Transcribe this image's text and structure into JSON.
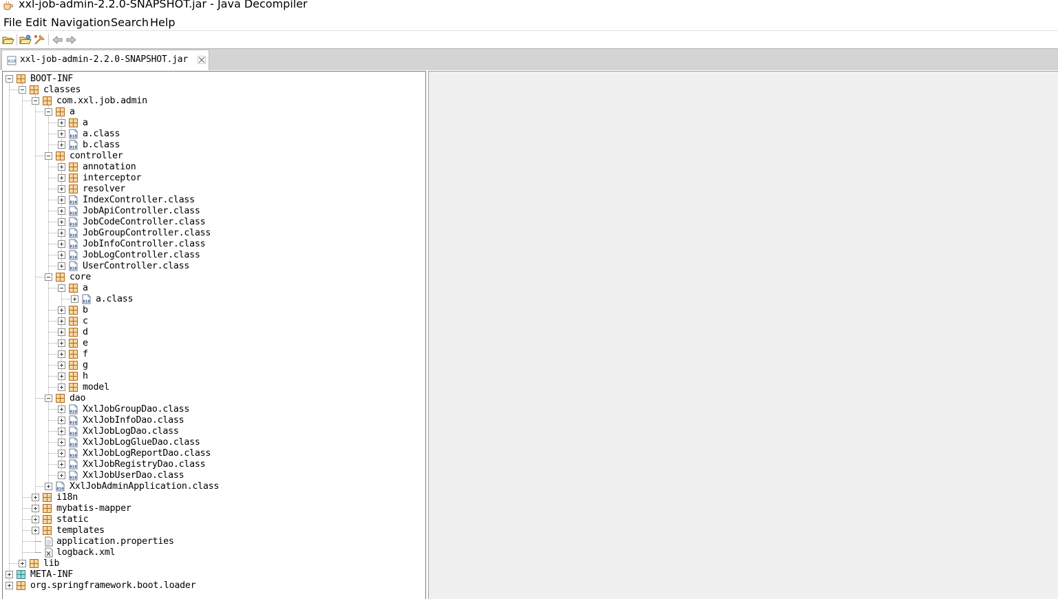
{
  "window": {
    "title": "xxl-job-admin-2.2.0-SNAPSHOT.jar - Java Decompiler"
  },
  "menu": [
    "File",
    "Edit",
    "Navigation",
    "Search",
    "Help"
  ],
  "toolbar": {
    "buttons": [
      "open-file-icon",
      "open-type-icon",
      "reference-icon",
      "back-icon",
      "forward-icon"
    ]
  },
  "tab": {
    "label": "xxl-job-admin-2.2.0-SNAPSHOT.jar"
  },
  "tree": [
    {
      "label": "BOOT-INF",
      "depth": 0,
      "type": "package",
      "state": "expanded"
    },
    {
      "label": "classes",
      "depth": 1,
      "type": "package",
      "state": "expanded"
    },
    {
      "label": "com.xxl.job.admin",
      "depth": 2,
      "type": "package",
      "state": "expanded"
    },
    {
      "label": "a",
      "depth": 3,
      "type": "package",
      "state": "expanded"
    },
    {
      "label": "a",
      "depth": 4,
      "type": "package",
      "state": "collapsed"
    },
    {
      "label": "a.class",
      "depth": 4,
      "type": "class",
      "state": "collapsed"
    },
    {
      "label": "b.class",
      "depth": 4,
      "type": "class",
      "state": "collapsed"
    },
    {
      "label": "controller",
      "depth": 3,
      "type": "package",
      "state": "expanded"
    },
    {
      "label": "annotation",
      "depth": 4,
      "type": "package",
      "state": "collapsed"
    },
    {
      "label": "interceptor",
      "depth": 4,
      "type": "package",
      "state": "collapsed"
    },
    {
      "label": "resolver",
      "depth": 4,
      "type": "package",
      "state": "collapsed"
    },
    {
      "label": "IndexController.class",
      "depth": 4,
      "type": "class",
      "state": "collapsed"
    },
    {
      "label": "JobApiController.class",
      "depth": 4,
      "type": "class",
      "state": "collapsed"
    },
    {
      "label": "JobCodeController.class",
      "depth": 4,
      "type": "class",
      "state": "collapsed"
    },
    {
      "label": "JobGroupController.class",
      "depth": 4,
      "type": "class",
      "state": "collapsed"
    },
    {
      "label": "JobInfoController.class",
      "depth": 4,
      "type": "class",
      "state": "collapsed"
    },
    {
      "label": "JobLogController.class",
      "depth": 4,
      "type": "class",
      "state": "collapsed"
    },
    {
      "label": "UserController.class",
      "depth": 4,
      "type": "class",
      "state": "collapsed"
    },
    {
      "label": "core",
      "depth": 3,
      "type": "package",
      "state": "expanded"
    },
    {
      "label": "a",
      "depth": 4,
      "type": "package",
      "state": "expanded"
    },
    {
      "label": "a.class",
      "depth": 5,
      "type": "class",
      "state": "collapsed"
    },
    {
      "label": "b",
      "depth": 4,
      "type": "package",
      "state": "collapsed"
    },
    {
      "label": "c",
      "depth": 4,
      "type": "package",
      "state": "collapsed"
    },
    {
      "label": "d",
      "depth": 4,
      "type": "package",
      "state": "collapsed"
    },
    {
      "label": "e",
      "depth": 4,
      "type": "package",
      "state": "collapsed"
    },
    {
      "label": "f",
      "depth": 4,
      "type": "package",
      "state": "collapsed"
    },
    {
      "label": "g",
      "depth": 4,
      "type": "package",
      "state": "collapsed"
    },
    {
      "label": "h",
      "depth": 4,
      "type": "package",
      "state": "collapsed"
    },
    {
      "label": "model",
      "depth": 4,
      "type": "package",
      "state": "collapsed"
    },
    {
      "label": "dao",
      "depth": 3,
      "type": "package",
      "state": "expanded"
    },
    {
      "label": "XxlJobGroupDao.class",
      "depth": 4,
      "type": "class",
      "state": "collapsed"
    },
    {
      "label": "XxlJobInfoDao.class",
      "depth": 4,
      "type": "class",
      "state": "collapsed"
    },
    {
      "label": "XxlJobLogDao.class",
      "depth": 4,
      "type": "class",
      "state": "collapsed"
    },
    {
      "label": "XxlJobLogGlueDao.class",
      "depth": 4,
      "type": "class",
      "state": "collapsed"
    },
    {
      "label": "XxlJobLogReportDao.class",
      "depth": 4,
      "type": "class",
      "state": "collapsed"
    },
    {
      "label": "XxlJobRegistryDao.class",
      "depth": 4,
      "type": "class",
      "state": "collapsed"
    },
    {
      "label": "XxlJobUserDao.class",
      "depth": 4,
      "type": "class",
      "state": "collapsed"
    },
    {
      "label": "XxlJobAdminApplication.class",
      "depth": 3,
      "type": "class",
      "state": "collapsed"
    },
    {
      "label": "i18n",
      "depth": 2,
      "type": "package",
      "state": "collapsed"
    },
    {
      "label": "mybatis-mapper",
      "depth": 2,
      "type": "package",
      "state": "collapsed"
    },
    {
      "label": "static",
      "depth": 2,
      "type": "package",
      "state": "collapsed"
    },
    {
      "label": "templates",
      "depth": 2,
      "type": "package",
      "state": "collapsed"
    },
    {
      "label": "application.properties",
      "depth": 2,
      "type": "file",
      "state": "leaf"
    },
    {
      "label": "logback.xml",
      "depth": 2,
      "type": "xml",
      "state": "leaf"
    },
    {
      "label": "lib",
      "depth": 1,
      "type": "package",
      "state": "collapsed"
    },
    {
      "label": "META-INF",
      "depth": 0,
      "type": "meta",
      "state": "collapsed"
    },
    {
      "label": "org.springframework.boot.loader",
      "depth": 0,
      "type": "package",
      "state": "collapsed"
    }
  ]
}
